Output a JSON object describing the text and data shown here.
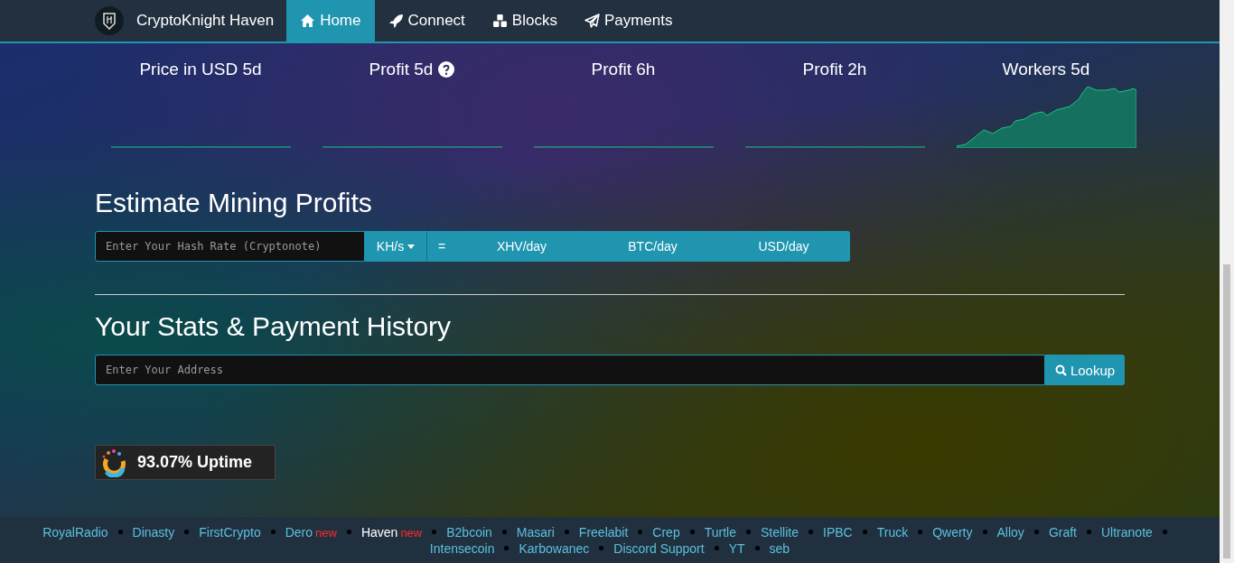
{
  "navbar": {
    "brand": "CryptoKnight Haven",
    "items": [
      {
        "label": "Home",
        "selected": true
      },
      {
        "label": "Connect",
        "selected": false
      },
      {
        "label": "Blocks",
        "selected": false
      },
      {
        "label": "Payments",
        "selected": false
      }
    ]
  },
  "stats": [
    {
      "title": "Price in USD 5d",
      "help": false,
      "kind": "flat"
    },
    {
      "title": "Profit 5d",
      "help": true,
      "kind": "flat"
    },
    {
      "title": "Profit 6h",
      "help": false,
      "kind": "flat"
    },
    {
      "title": "Profit 2h",
      "help": false,
      "kind": "flat"
    },
    {
      "title": "Workers 5d",
      "help": false,
      "kind": "area"
    }
  ],
  "estimate": {
    "title": "Estimate Mining Profits",
    "placeholder": "Enter Your Hash Rate (Cryptonote)",
    "unit": "KH/s",
    "equals": "=",
    "results": [
      "XHV/day",
      "BTC/day",
      "USD/day"
    ]
  },
  "lookup": {
    "title": "Your Stats & Payment History",
    "placeholder": "Enter Your Address",
    "button": "Lookup"
  },
  "uptime": "93.07% Uptime",
  "footer": [
    {
      "label": "RoyalRadio",
      "selected": false
    },
    {
      "label": "Dinasty",
      "selected": false
    },
    {
      "label": "FirstCrypto",
      "selected": false
    },
    {
      "label": "Dero",
      "selected": false,
      "badge": "new"
    },
    {
      "label": "Haven",
      "selected": true,
      "badge": "new"
    },
    {
      "label": "B2bcoin",
      "selected": false
    },
    {
      "label": "Masari",
      "selected": false
    },
    {
      "label": "Freelabit",
      "selected": false
    },
    {
      "label": "Crep",
      "selected": false
    },
    {
      "label": "Turtle",
      "selected": false
    },
    {
      "label": "Stellite",
      "selected": false
    },
    {
      "label": "IPBC",
      "selected": false
    },
    {
      "label": "Truck",
      "selected": false
    },
    {
      "label": "Qwerty",
      "selected": false
    },
    {
      "label": "Alloy",
      "selected": false
    },
    {
      "label": "Graft",
      "selected": false
    },
    {
      "label": "Ultranote",
      "selected": false
    },
    {
      "label": "Intensecoin",
      "selected": false
    },
    {
      "label": "Karbowanec",
      "selected": false
    },
    {
      "label": "Discord Support",
      "selected": false
    },
    {
      "label": "YT",
      "selected": false
    },
    {
      "label": "seb",
      "selected": false
    }
  ]
}
